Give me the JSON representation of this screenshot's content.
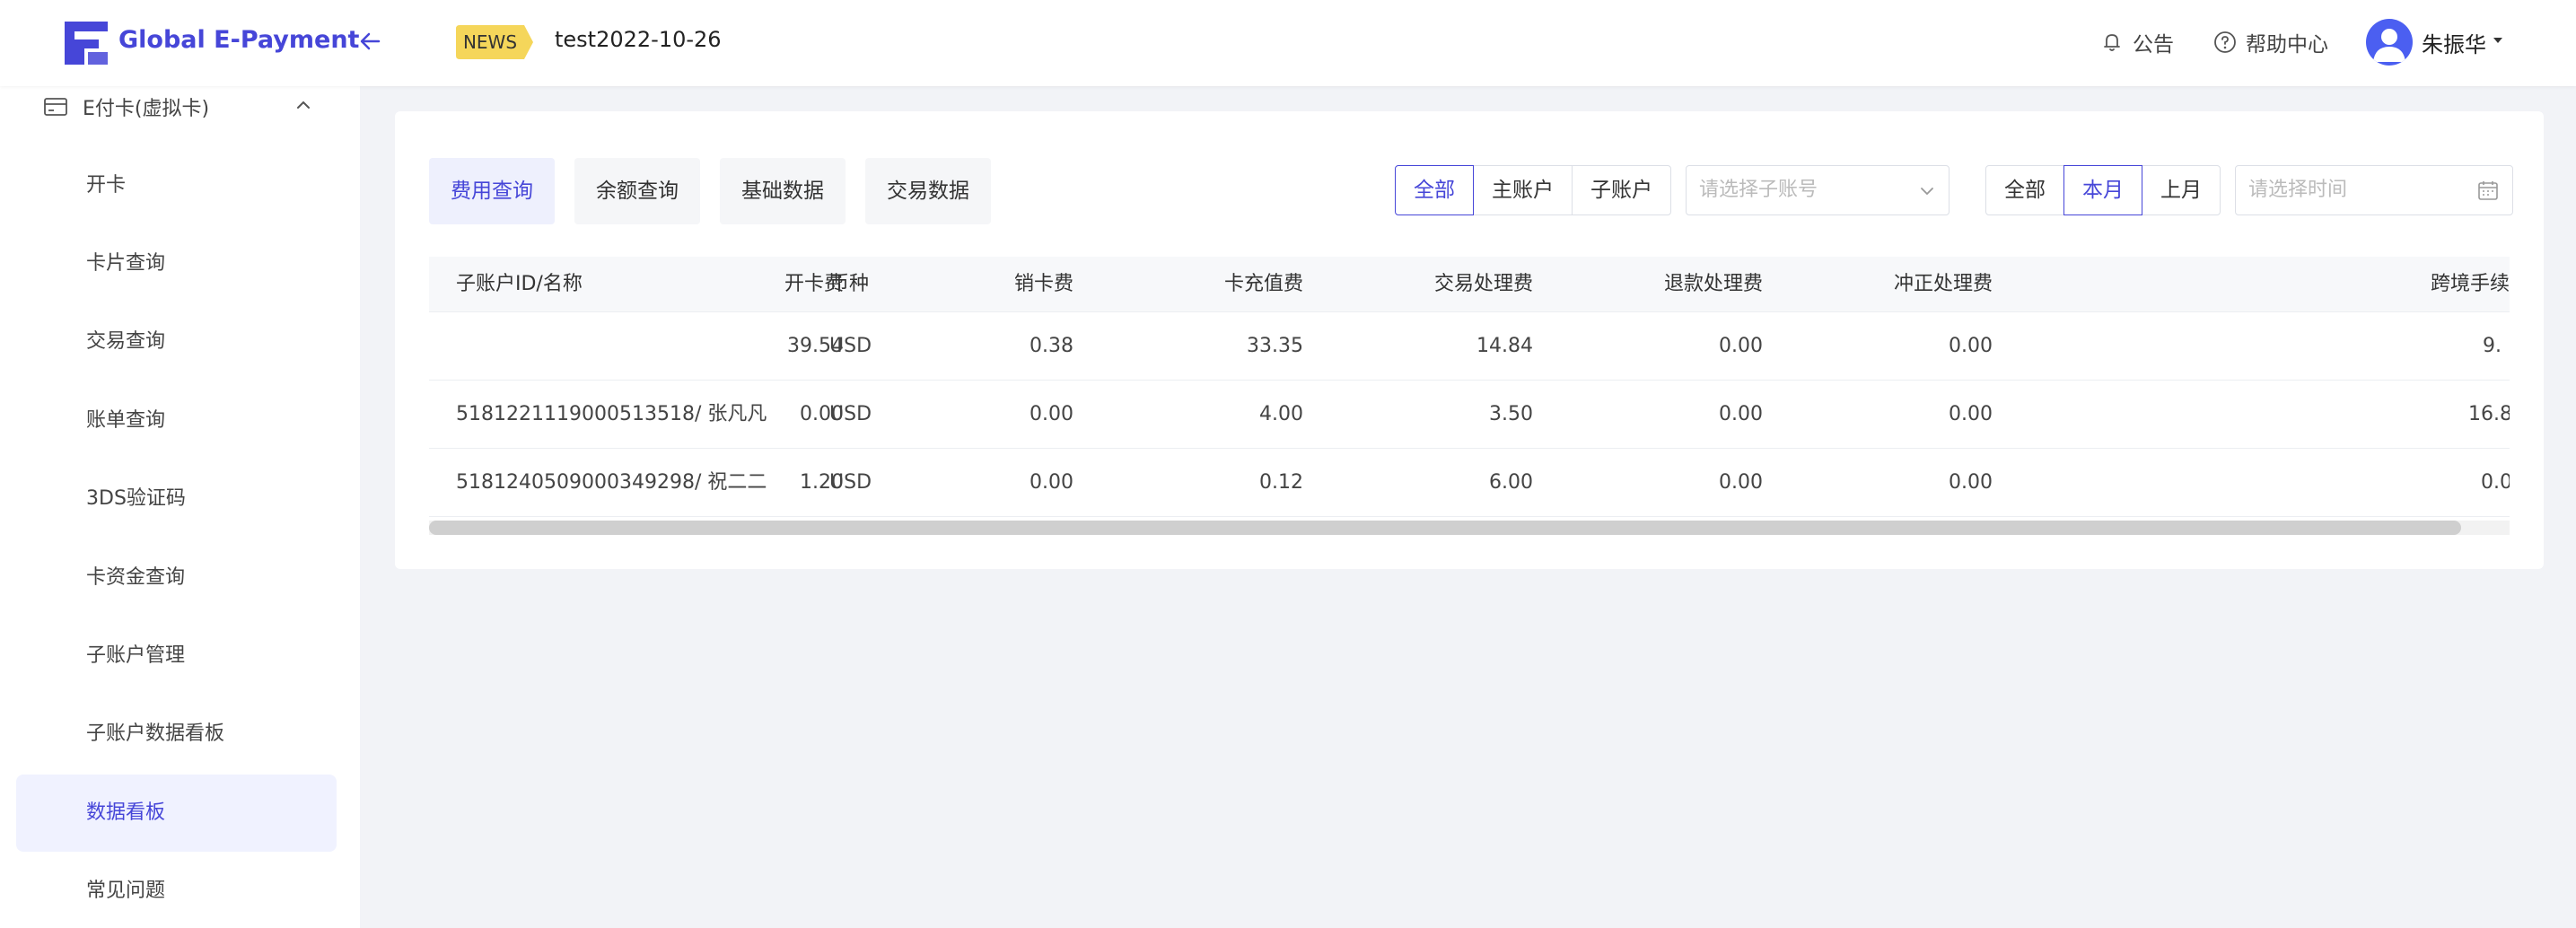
{
  "header": {
    "brand": "Global E-Payment",
    "news_badge": "NEWS",
    "news_title": "test2022-10-26",
    "announcement_label": "公告",
    "help_label": "帮助中心",
    "username": "朱振华",
    "colors": {
      "brand": "#4646d8",
      "avatar": "#4b5ff1",
      "badge": "#f5d65a"
    }
  },
  "sidebar": {
    "group_label": "E付卡(虚拟卡)",
    "items": [
      {
        "label": "开卡",
        "active": false
      },
      {
        "label": "卡片查询",
        "active": false
      },
      {
        "label": "交易查询",
        "active": false
      },
      {
        "label": "账单查询",
        "active": false
      },
      {
        "label": "3DS验证码",
        "active": false
      },
      {
        "label": "卡资金查询",
        "active": false
      },
      {
        "label": "子账户管理",
        "active": false
      },
      {
        "label": "子账户数据看板",
        "active": false
      },
      {
        "label": "数据看板",
        "active": true
      },
      {
        "label": "常见问题",
        "active": false
      }
    ]
  },
  "main": {
    "tabs": [
      {
        "label": "费用查询",
        "active": true
      },
      {
        "label": "余额查询",
        "active": false
      },
      {
        "label": "基础数据",
        "active": false
      },
      {
        "label": "交易数据",
        "active": false
      }
    ],
    "account_filter": [
      "全部",
      "主账户",
      "子账户"
    ],
    "account_filter_selected": "全部",
    "subaccount_select_placeholder": "请选择子账号",
    "period_filter": [
      "全部",
      "本月",
      "上月"
    ],
    "period_filter_selected": "本月",
    "date_placeholder": "请选择时间",
    "table": {
      "columns": [
        "子账户ID/名称",
        "币种",
        "开卡费",
        "销卡费",
        "卡充值费",
        "交易处理费",
        "退款处理费",
        "冲正处理费",
        "跨境手续费"
      ],
      "rows": [
        [
          "",
          "USD",
          "39.54",
          "0.38",
          "33.35",
          "14.84",
          "0.00",
          "0.00",
          "9."
        ],
        [
          "5181221119000513518/ 张凡凡",
          "USD",
          "0.00",
          "0.00",
          "4.00",
          "3.50",
          "0.00",
          "0.00",
          "16.8"
        ],
        [
          "5181240509000349298/ 祝二二",
          "USD",
          "1.20",
          "0.00",
          "0.12",
          "6.00",
          "0.00",
          "0.00",
          "0.0"
        ]
      ]
    }
  }
}
